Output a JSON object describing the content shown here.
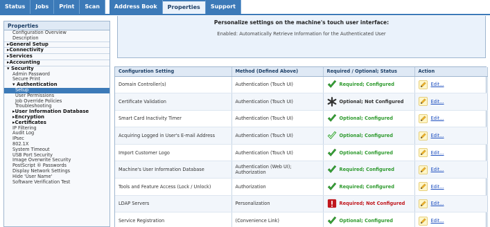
{
  "tabs": {
    "group1": [
      "Status",
      "Jobs",
      "Print",
      "Scan"
    ],
    "group2": [
      "Address Book",
      "Properties",
      "Support"
    ],
    "active": "Properties"
  },
  "nav": {
    "title": "Properties",
    "items": [
      {
        "label": "Configuration Overview",
        "style": "sub"
      },
      {
        "label": "Description",
        "style": "sub"
      },
      {
        "label": "▸General Setup",
        "style": "bold"
      },
      {
        "label": "▸Connectivity",
        "style": "bold"
      },
      {
        "label": "▸Services",
        "style": "bold"
      },
      {
        "label": "▸Accounting",
        "style": "bold"
      },
      {
        "label": "▾ Security",
        "style": "bold"
      },
      {
        "label": "Admin Password",
        "style": "sub"
      },
      {
        "label": "Secure Print",
        "style": "sub"
      },
      {
        "label": "▾ Authentication",
        "style": "boldsub"
      },
      {
        "label": "Setup",
        "style": "selected"
      },
      {
        "label": "User Permissions",
        "style": "subsub"
      },
      {
        "label": "Job Override Policies",
        "style": "subsub"
      },
      {
        "label": "Troubleshooting",
        "style": "subsub"
      },
      {
        "label": "▸User Information Database",
        "style": "boldsub"
      },
      {
        "label": "▸Encryption",
        "style": "boldsub"
      },
      {
        "label": "▸Certificates",
        "style": "boldsub"
      },
      {
        "label": "IP Filtering",
        "style": "sub"
      },
      {
        "label": "Audit Log",
        "style": "sub"
      },
      {
        "label": "IPsec",
        "style": "sub"
      },
      {
        "label": "802.1X",
        "style": "sub"
      },
      {
        "label": "System Timeout",
        "style": "sub"
      },
      {
        "label": "USB Port Security",
        "style": "sub"
      },
      {
        "label": "Image Overwrite Security",
        "style": "sub"
      },
      {
        "label": "PostScript ® Passwords",
        "style": "sub"
      },
      {
        "label": "Display Network Settings",
        "style": "sub"
      },
      {
        "label": "Hide 'User Name'",
        "style": "sub"
      },
      {
        "label": "Software Verification Test",
        "style": "sub"
      }
    ]
  },
  "info": {
    "heading": "Personalize settings on the machine's touch user interface:",
    "text": "Enabled: Automatically Retrieve Information for the Authenticated User"
  },
  "table": {
    "headers": [
      "Configuration Setting",
      "Method (Defined Above)",
      "Required / Optional; Status",
      "Action"
    ],
    "rows": [
      {
        "setting": "Domain Controller(s)",
        "method": "Authentication (Touch UI)",
        "status": "Required; Configured",
        "kind": "ok",
        "action": "Edit..."
      },
      {
        "setting": "Certificate Validation",
        "method": "Authentication (Touch UI)",
        "status": "Optional; Not Configured",
        "kind": "na",
        "action": "Edit..."
      },
      {
        "setting": "Smart Card Inactivity Timer",
        "method": "Authentication (Touch UI)",
        "status": "Optional; Configured",
        "kind": "opt",
        "action": "Edit..."
      },
      {
        "setting": "Acquiring Logged in User's E-mail Address",
        "method": "Authentication (Touch UI)",
        "status": "Optional; Configured",
        "kind": "optoutline",
        "action": "Edit..."
      },
      {
        "setting": "Import Customer Logo",
        "method": "Authentication (Touch UI)",
        "status": "Optional; Configured",
        "kind": "opt",
        "action": "Edit..."
      },
      {
        "setting": "Machine's User Information Database",
        "method": "Authentication (Web UI); Authorization",
        "status": "Required; Configured",
        "kind": "ok",
        "action": "Edit..."
      },
      {
        "setting": "Tools and Feature Access (Lock / Unlock)",
        "method": "Authorization",
        "status": "Required; Configured",
        "kind": "ok",
        "action": "Edit..."
      },
      {
        "setting": "LDAP Servers",
        "method": "Personalization",
        "status": "Required; Not Configured",
        "kind": "err",
        "action": "Edit..."
      },
      {
        "setting": "Service Registration",
        "method": "(Convenience Link)",
        "status": "Optional; Configured",
        "kind": "opt",
        "action": "Edit..."
      }
    ]
  },
  "colors": {
    "accent": "#3c7ab8",
    "ok": "#2e9a2e",
    "error": "#c0161c"
  }
}
